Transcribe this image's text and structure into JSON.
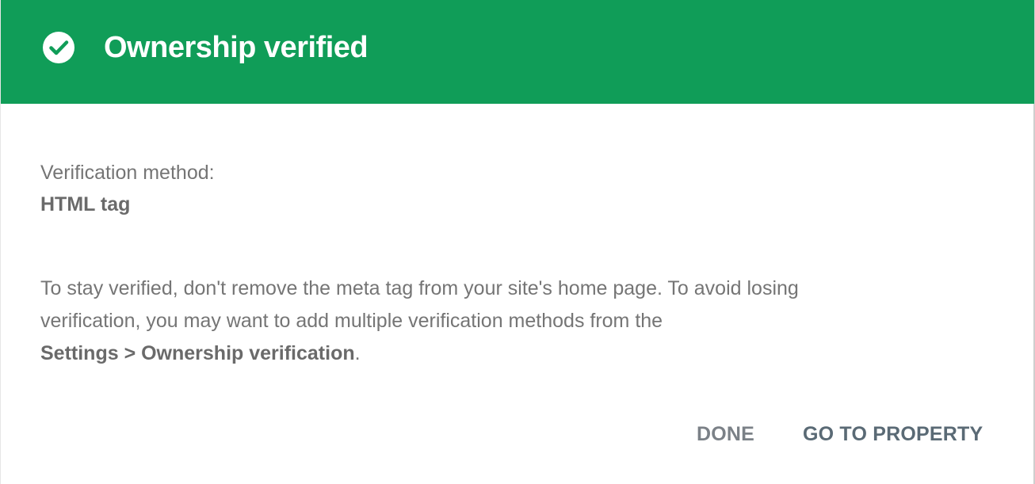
{
  "header": {
    "title": "Ownership verified",
    "icon": "check-circle-icon",
    "bg_color": "#109d58"
  },
  "body": {
    "method_label": "Verification method:",
    "method_value": "HTML tag",
    "info_line1": "To stay verified, don't remove the meta tag from your site's home page. To avoid losing",
    "info_line2": "verification, you may want to add multiple verification methods from the",
    "info_link": "Settings > Ownership verification",
    "info_end": "."
  },
  "actions": {
    "done_label": "DONE",
    "go_label": "GO TO PROPERTY"
  }
}
